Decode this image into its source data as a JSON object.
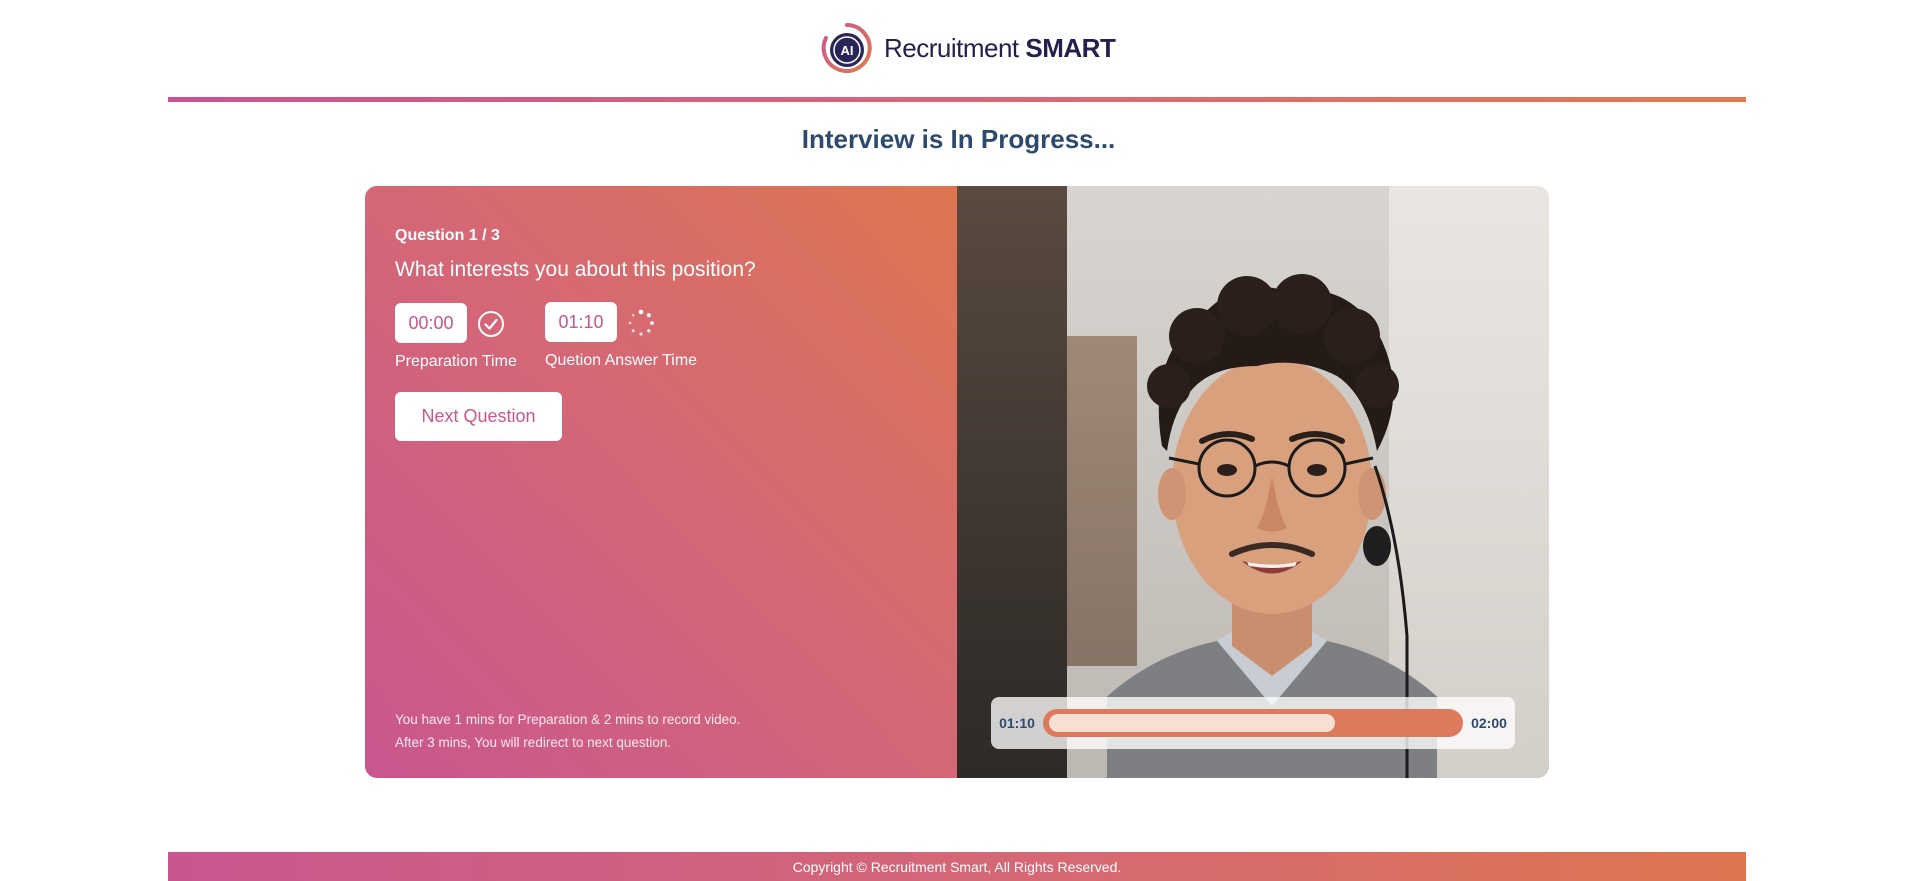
{
  "header": {
    "logo_mark_text": "AI",
    "brand_light": "Recruitment",
    "brand_bold": "SMART"
  },
  "page_title": "Interview is In Progress...",
  "question": {
    "counter": "Question 1 / 3",
    "text": "What interests you about this position?"
  },
  "timers": {
    "preparation_value": "00:00",
    "preparation_label": "Preparation Time",
    "preparation_icon": "check-circle-icon",
    "answer_value": "01:10",
    "answer_label": "Quetion Answer Time",
    "answer_icon": "loading-spinner-icon"
  },
  "next_button_label": "Next Question",
  "note": {
    "line1": "You have 1 mins for Preparation & 2 mins to record video.",
    "line2": "After 3 mins, You will redirect to next question."
  },
  "video": {
    "elapsed": "01:10",
    "total": "02:00",
    "progress_fraction": 0.7
  },
  "footer": {
    "copyright": "Copyright © Recruitment Smart, All Rights Reserved."
  },
  "colors": {
    "brand_pink": "#c9568f",
    "brand_orange": "#de7550",
    "title_blue": "#2d4a6e",
    "logo_navy": "#23204f"
  }
}
